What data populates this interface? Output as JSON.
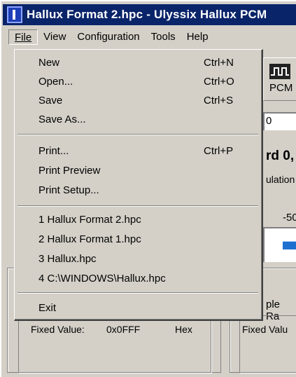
{
  "window": {
    "title": "Hallux Format 2.hpc - Ulyssix Hallux PCM"
  },
  "menubar": {
    "file": "File",
    "view": "View",
    "configuration": "Configuration",
    "tools": "Tools",
    "help": "Help"
  },
  "file_menu": {
    "new": {
      "label": "New",
      "shortcut": "Ctrl+N"
    },
    "open": {
      "label": "Open...",
      "shortcut": "Ctrl+O"
    },
    "save": {
      "label": "Save",
      "shortcut": "Ctrl+S"
    },
    "save_as": {
      "label": "Save As..."
    },
    "print": {
      "label": "Print...",
      "shortcut": "Ctrl+P"
    },
    "print_preview": {
      "label": "Print Preview"
    },
    "print_setup": {
      "label": "Print Setup..."
    },
    "recent": [
      "1 Hallux Format 2.hpc",
      "2 Hallux Format 1.hpc",
      "3 Hallux.hpc",
      "4 C:\\WINDOWS\\Hallux.hpc"
    ],
    "exit": {
      "label": "Exit"
    }
  },
  "background": {
    "pcm_label": "PCM",
    "field_value": "0",
    "record_text": "rd 0,",
    "modulation_text": "ulation",
    "scale_text": "-50",
    "sample_rate_text": "ple Ra",
    "fixed_value_left_label": "Fixed Value:",
    "fixed_value_left_value": "0x0FFF",
    "fixed_value_left_unit": "Hex",
    "fixed_value_right_label": "Fixed Valu"
  },
  "colors": {
    "titlebar": "#0a246a",
    "face": "#d4d0c8",
    "slider": "#1e70d0"
  }
}
